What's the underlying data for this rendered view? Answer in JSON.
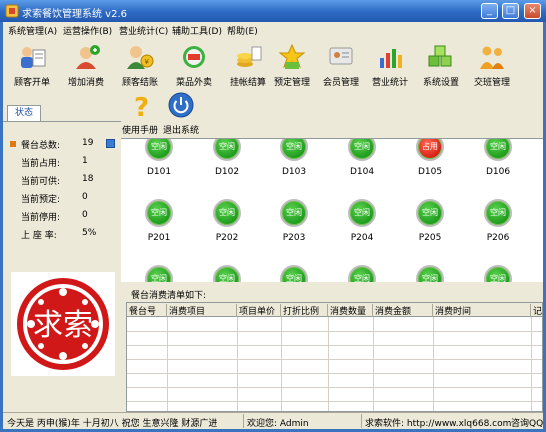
{
  "window": {
    "title": "求索餐饮管理系统 v2.6"
  },
  "menu": [
    {
      "label": "系统管理(A)"
    },
    {
      "label": "运营操作(B)"
    },
    {
      "label": "营业统计(C)"
    },
    {
      "label": "辅助工具(D)"
    },
    {
      "label": "帮助(E)"
    }
  ],
  "toolbar": [
    {
      "label": "顾客开单",
      "icon": "open-order-icon"
    },
    {
      "label": "增加消费",
      "icon": "add-consumption-icon"
    },
    {
      "label": "顾客结账",
      "icon": "checkout-icon"
    },
    {
      "label": "菜品外卖",
      "icon": "takeout-sale-icon"
    },
    {
      "label": "挂帐结算",
      "icon": "credit-settle-icon"
    },
    {
      "label": "预定管理",
      "icon": "reservation-icon"
    },
    {
      "label": "会员管理",
      "icon": "member-icon"
    },
    {
      "label": "营业统计",
      "icon": "stats-chart-icon"
    },
    {
      "label": "系统设置",
      "icon": "settings-cubes-icon"
    },
    {
      "label": "交班管理",
      "icon": "shift-handover-icon"
    },
    {
      "label": "使用手册",
      "icon": "help-manual-icon"
    },
    {
      "label": "退出系统",
      "icon": "power-exit-icon"
    }
  ],
  "side": {
    "tab_label": "状态",
    "stats": [
      {
        "label": "餐台总数:",
        "value": "19"
      },
      {
        "label": "当前占用:",
        "value": "1"
      },
      {
        "label": "当前可供:",
        "value": "18"
      },
      {
        "label": "当前预定:",
        "value": "0"
      },
      {
        "label": "当前停用:",
        "value": "0"
      },
      {
        "label": "上 座 率:",
        "value": "5%"
      }
    ],
    "seal_text": "求索"
  },
  "tables": {
    "rows": [
      [
        {
          "name": "D101",
          "state": "空闲",
          "status": "free"
        },
        {
          "name": "D102",
          "state": "空闲",
          "status": "free"
        },
        {
          "name": "D103",
          "state": "空闲",
          "status": "free"
        },
        {
          "name": "D104",
          "state": "空闲",
          "status": "free"
        },
        {
          "name": "D105",
          "state": "占用",
          "status": "busy"
        },
        {
          "name": "D106",
          "state": "空闲",
          "status": "free"
        }
      ],
      [
        {
          "name": "P201",
          "state": "空闲",
          "status": "free"
        },
        {
          "name": "P202",
          "state": "空闲",
          "status": "free"
        },
        {
          "name": "P203",
          "state": "空闲",
          "status": "free"
        },
        {
          "name": "P204",
          "state": "空闲",
          "status": "free"
        },
        {
          "name": "P205",
          "state": "空闲",
          "status": "free"
        },
        {
          "name": "P206",
          "state": "空闲",
          "status": "free"
        }
      ],
      [
        {
          "name": "",
          "state": "空闲",
          "status": "free"
        },
        {
          "name": "",
          "state": "空闲",
          "status": "free"
        },
        {
          "name": "",
          "state": "空闲",
          "status": "free"
        },
        {
          "name": "",
          "state": "空闲",
          "status": "free"
        },
        {
          "name": "",
          "state": "空闲",
          "status": "free"
        },
        {
          "name": "",
          "state": "空闲",
          "status": "free"
        }
      ]
    ]
  },
  "consumption": {
    "title": "餐台消费清单如下:",
    "columns": [
      "餐台号",
      "消费项目",
      "项目单价",
      "打折比例",
      "消费数量",
      "消费金额",
      "消费时间",
      "记"
    ]
  },
  "statusbar": {
    "date": "今天是 丙申(猴)年 十月初八 祝您 生意兴隆 财源广进",
    "welcome": "欢迎您: Admin",
    "site": "求索软件: http://www.xlq668.com",
    "contact": "咨询QQ"
  },
  "colors": {
    "title_blue": "#2d6ac4",
    "panel_bg": "#ece9d8",
    "free_green": "#1c9a1c",
    "busy_red": "#d81c12"
  }
}
